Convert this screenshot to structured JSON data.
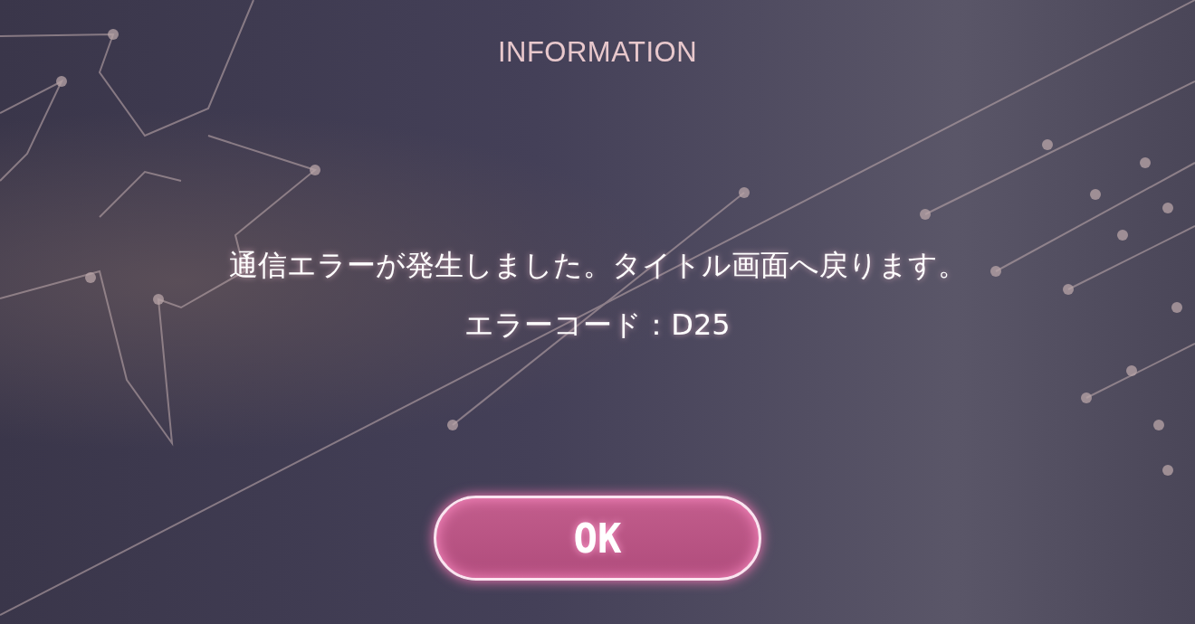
{
  "dialog": {
    "title": "INFORMATION",
    "message": "通信エラーが発生しました。タイトル画面へ戻ります。",
    "error_code": "エラーコード：D25"
  },
  "buttons": [
    {
      "label": "OK",
      "kind": "primary"
    }
  ]
}
